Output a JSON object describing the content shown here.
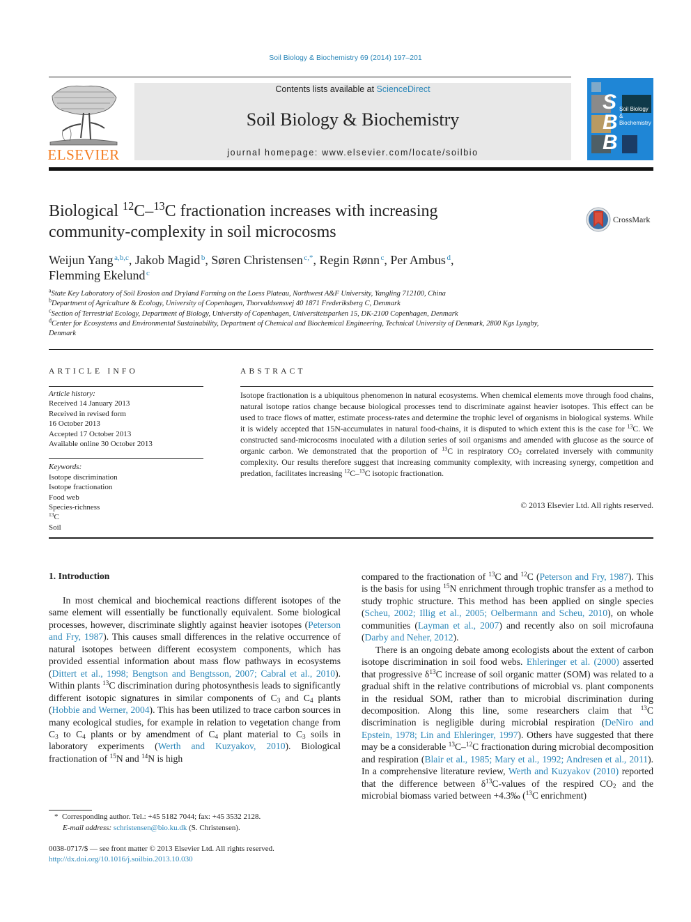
{
  "header": {
    "citation": "Soil Biology & Biochemistry 69 (2014) 197–201",
    "publisher_logo_text": "ELSEVIER",
    "contents_prefix": "Contents lists available at ",
    "contents_link": "ScienceDirect",
    "journal_name": "Soil Biology & Biochemistry",
    "homepage_prefix": "journal homepage: ",
    "homepage_url": "www.elsevier.com/locate/soilbio",
    "cover": {
      "letters": [
        "S",
        "B",
        "B"
      ],
      "title_line1": "Soil Biology &",
      "title_line2": "Biochemistry",
      "color": "#1f86d6"
    },
    "accent_color": "#2a86b8",
    "logo_color": "#f47c20"
  },
  "article": {
    "title_part1": "Biological ",
    "title_sup1": "12",
    "title_part2": "C–",
    "title_sup2": "13",
    "title_part3": "C fractionation increases with increasing",
    "title_line2": "community-complexity in soil microcosms",
    "crossmark_label": "CrossMark",
    "authors": [
      {
        "name": "Weijun Yang",
        "aff": "a,b,c",
        "sep": ", "
      },
      {
        "name": "Jakob Magid",
        "aff": "b",
        "sep": ", "
      },
      {
        "name": "Søren Christensen",
        "aff": "c,*",
        "sep": ", "
      },
      {
        "name": "Regin Rønn",
        "aff": "c",
        "sep": ", "
      },
      {
        "name": "Per Ambus",
        "aff": "d",
        "sep": ","
      },
      {
        "name": "Flemming Ekelund",
        "aff": "c",
        "sep": ""
      }
    ],
    "affiliations": [
      {
        "key": "a",
        "text": "State Key Laboratory of Soil Erosion and Dryland Farming on the Loess Plateau, Northwest A&F University, Yangling 712100, China"
      },
      {
        "key": "b",
        "text": "Department of Agriculture & Ecology, University of Copenhagen, Thorvaldsensvej 40 1871 Frederiksberg C, Denmark"
      },
      {
        "key": "c",
        "text": "Section of Terrestrial Ecology, Department of Biology, University of Copenhagen, Universitetsparken 15, DK-2100 Copenhagen, Denmark"
      },
      {
        "key": "d",
        "text": "Center for Ecosystems and Environmental Sustainability, Department of Chemical and Biochemical Engineering, Technical University of Denmark, 2800 Kgs Lyngby, Denmark"
      }
    ]
  },
  "article_info": {
    "heading": "ARTICLE INFO",
    "history_label": "Article history:",
    "history": [
      "Received 14 January 2013",
      "Received in revised form",
      "16 October 2013",
      "Accepted 17 October 2013",
      "Available online 30 October 2013"
    ],
    "keywords_label": "Keywords:",
    "keywords": [
      "Isotope discrimination",
      "Isotope fractionation",
      "Food web",
      "Species-richness",
      "13C",
      "Soil"
    ]
  },
  "abstract": {
    "heading": "ABSTRACT",
    "s1": "Isotope fractionation is a ubiquitous phenomenon in natural ecosystems. When chemical elements move through food chains, natural isotope ratios change because biological processes tend to discriminate against heavier isotopes. This effect can be used to trace flows of matter, estimate process-rates and determine the trophic level of organisms in biological systems. While it is widely accepted that 15N-accumulates in natural food-chains, it is disputed to which extent this is the case for ",
    "s2": "C. We constructed sand-microcosms inoculated with a dilution series of soil organisms and amended with glucose as the source of organic carbon. We demonstrated that the proportion of ",
    "s3": "C in respiratory CO",
    "s4": " correlated inversely with community complexity. Our results therefore suggest that increasing community complexity, with increasing synergy, competition and predation, facilitates increasing ",
    "s5": "C–",
    "s6": "C isotopic fractionation.",
    "copyright": "© 2013 Elsevier Ltd. All rights reserved."
  },
  "introduction": {
    "heading": "1.  Introduction",
    "refs": {
      "peterson_fry": "Peterson and Fry, 1987",
      "dittert": "Dittert et al., 1998; Bengtson and Bengtsson, 2007; Cabral et al., 2010",
      "hobbie": "Hobbie and Werner, 2004",
      "werth": "Werth and Kuzyakov, 2010",
      "peterson_fry_r": "Peterson and Fry, 1987",
      "scheu": "Scheu, 2002; Illig et al., 2005; Oelbermann and Scheu, 2010",
      "layman": "Layman et al., 2007",
      "darby": "Darby and Neher, 2012",
      "ehleringer": "Ehleringer et al. (2000)",
      "deniro": "DeNiro and Epstein, 1978; Lin and Ehleringer, 1997",
      "blair": "Blair et al., 1985; Mary et al., 1992; Andresen et al., 2011",
      "werth_r": "Werth and Kuzyakov (2010)"
    },
    "text": {
      "p1a": "In most chemical and biochemical reactions different isotopes of the same element will essentially be functionally equivalent. Some biological processes, however, discriminate slightly against heavier isotopes (",
      "p1b": "). This causes small differences in the relative occurrence of natural isotopes between different ecosystem components, which has provided essential information about mass flow pathways in ecosystems (",
      "p1c": "). Within plants ",
      "p1d": "C discrimination during photosynthesis leads to significantly different isotopic signatures in similar components of C",
      "p1e": " and C",
      "p1f": " plants (",
      "p1g": "). This has been utilized to trace carbon sources in many ecological studies, for example in relation to vegetation change from C",
      "p1h": " to C",
      "p1i": " plants or by amendment of C",
      "p1j": " plant material to C",
      "p1k": " soils in laboratory experiments (",
      "p1l": "). Biological fractionation of ",
      "p1m": "N and ",
      "p1n": "N is high",
      "r1a": "compared to the fractionation of ",
      "r1b": "C and ",
      "r1c": "C (",
      "r1d": "). This is the basis for using ",
      "r1e": "N enrichment through trophic transfer as a method to study trophic structure. This method has been applied on single species (",
      "r1f": "), on whole communities (",
      "r1g": ") and recently also on soil microfauna (",
      "r1h": ").",
      "r2a": "There is an ongoing debate among ecologists about the extent of carbon isotope discrimination in soil food webs. ",
      "r2b": " asserted that progressive δ",
      "r2c": "C increase of soil organic matter (SOM) was related to a gradual shift in the relative contributions of microbial vs. plant components in the residual SOM, rather than to microbial discrimination during decomposition. Along this line, some researchers claim that ",
      "r2d": "C discrimination is negligible during microbial respiration (",
      "r2e": "). Others have suggested that there may be a considerable ",
      "r2f": "C–",
      "r2g": "C fractionation during microbial decomposition and respiration (",
      "r2h": "). In a comprehensive literature review, ",
      "r2i": " reported that the difference between δ",
      "r2j": "C-values of the respired CO",
      "r2k": " and the microbial biomass varied between +4.3‰ (",
      "r2l": "C enrichment)"
    },
    "sup": {
      "c12": "12",
      "c13": "13",
      "n14": "14",
      "n15": "15"
    },
    "sub": {
      "three": "3",
      "four": "4",
      "two": "2"
    }
  },
  "footnote": {
    "marker": "*",
    "corresponding": "Corresponding author. Tel.: +45 5182 7044; fax: +45 3532 2128.",
    "email_label": "E-mail address:",
    "email": "schristensen@bio.ku.dk",
    "email_suffix": " (S. Christensen)."
  },
  "front_matter": {
    "issn_line": "0038-0717/$ — see front matter © 2013 Elsevier Ltd. All rights reserved.",
    "doi": "http://dx.doi.org/10.1016/j.soilbio.2013.10.030"
  }
}
